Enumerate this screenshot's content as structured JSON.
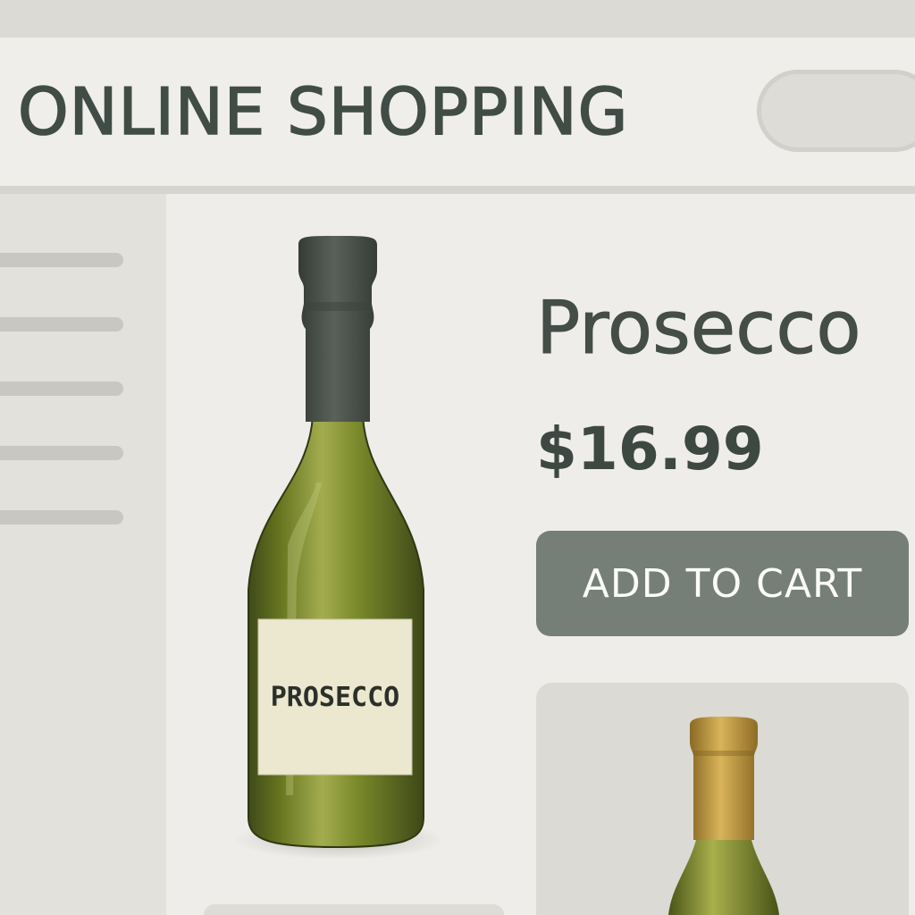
{
  "header": {
    "site_title": "ONLINE SHOPPING",
    "search": {
      "placeholder": ""
    }
  },
  "sidebar": {
    "menu_items": [
      "",
      "",
      "",
      "",
      ""
    ]
  },
  "product": {
    "name": "Prosecco",
    "price": "$16.99",
    "add_to_cart_label": "ADD TO CART",
    "image": {
      "icon": "wine-bottle-icon",
      "label_text": "PROSECCO"
    }
  },
  "related_product": {
    "image": {
      "icon": "gold-foil-bottle-icon"
    }
  },
  "colors": {
    "page_background": "#e6e4df",
    "header_background": "#efeeea",
    "text_primary": "#414c47",
    "button_background": "#767e78",
    "button_text": "#fbfbf8",
    "bottle_glass": "#6e7d2f",
    "bottle_foil": "#4a5149",
    "gold_foil": "#c9a24a"
  }
}
